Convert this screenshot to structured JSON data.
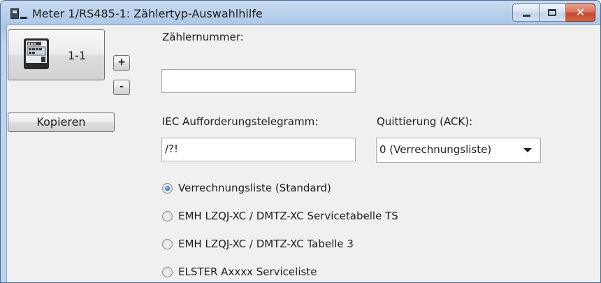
{
  "window": {
    "title": "Meter 1/RS485-1: Zählertyp-Auswahlhilfe"
  },
  "meter": {
    "label": "1-1",
    "plus_label": "+",
    "minus_label": "-"
  },
  "copy_button": {
    "label": "Kopieren"
  },
  "fields": {
    "meter_number_label": "Zählernummer:",
    "meter_number_value": "",
    "iec_label": "IEC Aufforderungstelegramm:",
    "iec_value": "/?!",
    "ack_label": "Quittierung (ACK):",
    "ack_value": "0 (Verrechnungsliste)"
  },
  "radio_options": [
    {
      "label": "Verrechnungsliste (Standard)",
      "checked": true
    },
    {
      "label": "EMH LZQJ-XC / DMTZ-XC Servicetabelle TS",
      "checked": false
    },
    {
      "label": "EMH LZQJ-XC / DMTZ-XC Tabelle 3",
      "checked": false
    },
    {
      "label": "ELSTER Axxxx Serviceliste",
      "checked": false
    }
  ],
  "icons": {
    "app": "meter-app-icon",
    "minimize": "minimize-icon",
    "maximize": "maximize-icon",
    "close": "close-icon",
    "meter": "electricity-meter-icon"
  }
}
